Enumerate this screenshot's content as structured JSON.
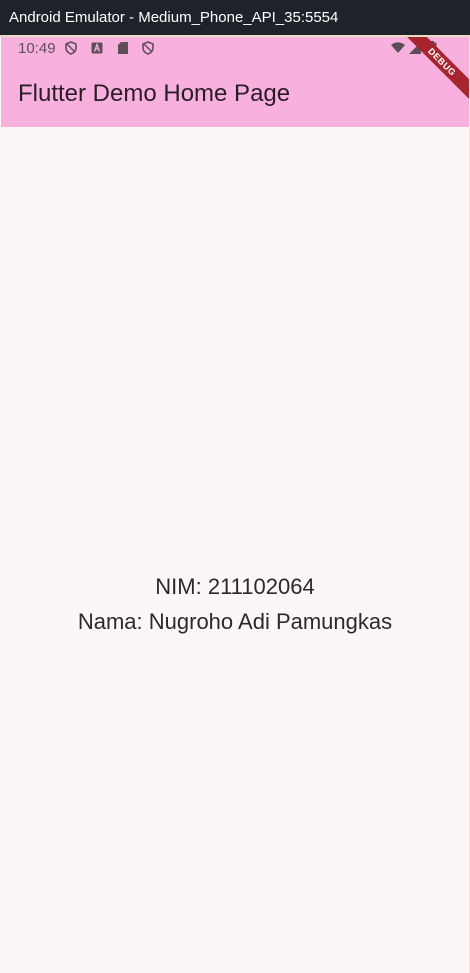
{
  "window": {
    "title": "Android Emulator - Medium_Phone_API_35:5554"
  },
  "status_bar": {
    "time": "10:49",
    "icons_left": [
      "shield-icon",
      "a-box-icon",
      "sd-card-icon",
      "shield-icon"
    ],
    "icons_right": [
      "wifi-icon",
      "signal-icon",
      "battery-icon"
    ]
  },
  "app_bar": {
    "title": "Flutter Demo Home Page",
    "background": "#f8b0de",
    "debug_banner": "DEBUG"
  },
  "content": {
    "nim": "NIM: 211102064",
    "nama": "Nama: Nugroho Adi Pamungkas"
  },
  "colors": {
    "titlebar": "#1f2229",
    "body_background": "#fdf6f7",
    "debug_ribbon": "#a6252f"
  }
}
